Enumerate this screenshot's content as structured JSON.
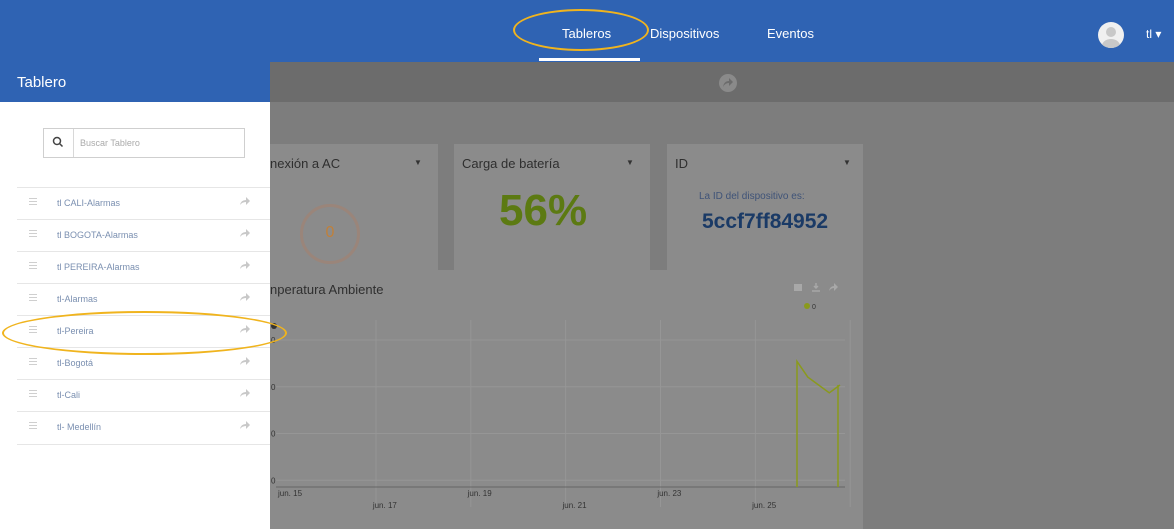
{
  "topbar": {
    "nav": [
      {
        "label": "Tableros"
      },
      {
        "label": "Dispositivos"
      },
      {
        "label": "Eventos"
      }
    ],
    "user_label": "tl ▾"
  },
  "sidebar": {
    "title": "Tablero",
    "search": {
      "placeholder": "Buscar Tablero",
      "value": ""
    },
    "items": [
      {
        "label": "tl CALI-Alarmas"
      },
      {
        "label": "tl BOGOTA-Alarmas"
      },
      {
        "label": "tl PEREIRA-Alarmas"
      },
      {
        "label": "tl-Alarmas"
      },
      {
        "label": "tl-Pereira"
      },
      {
        "label": "tl-Bogotá"
      },
      {
        "label": "tl-Cali"
      },
      {
        "label": "tl- Medellín"
      }
    ]
  },
  "dashboard": {
    "cards": {
      "ac": {
        "title": "nexión a AC",
        "value": "0"
      },
      "battery": {
        "title": "Carga de batería",
        "value": "56%"
      },
      "id": {
        "title": "ID",
        "caption": "La ID del dispositivo es:",
        "value": "5ccf7ff84952"
      }
    },
    "chart_card": {
      "title": "nperatura Ambiente"
    }
  },
  "colors": {
    "topbar": "#2f63b3",
    "overlay": "#7d7d7d",
    "highlight": "#f0b41e",
    "series": "#8a9a1c"
  },
  "chart_data": {
    "type": "line",
    "title": "nperatura Ambiente",
    "x_tick_labels": [
      "jun. 15",
      "jun. 17",
      "jun. 19",
      "jun. 21",
      "jun. 23",
      "jun. 25"
    ],
    "y_tick_labels": [
      "0",
      "0",
      "0",
      "0"
    ],
    "series": [
      {
        "name": "◆0",
        "points": [
          [
            0.0,
            0.0
          ],
          [
            0.0,
            0.8
          ],
          [
            0.1,
            0.7
          ],
          [
            0.3,
            0.6
          ],
          [
            0.4,
            0.65
          ]
        ]
      }
    ],
    "grid": true,
    "legend": "top-right"
  }
}
